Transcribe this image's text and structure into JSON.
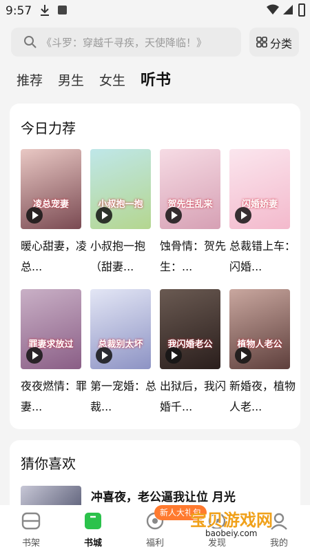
{
  "status_bar": {
    "time": "9:57"
  },
  "search": {
    "placeholder": "《斗罗：穿越千寻疾，天使降临！》"
  },
  "category_button": {
    "label": "分类"
  },
  "tabs": [
    {
      "label": "推荐",
      "active": false
    },
    {
      "label": "男生",
      "active": false
    },
    {
      "label": "女生",
      "active": false
    },
    {
      "label": "听书",
      "active": true
    }
  ],
  "recommend": {
    "title": "今日力荐",
    "books": [
      {
        "title": "暖心甜妻，凌总...",
        "cover_text": "凌总宠妻"
      },
      {
        "title": "小叔抱一抱（甜妻...",
        "cover_text": "小叔抱一抱"
      },
      {
        "title": "蚀骨情：贺先生：...",
        "cover_text": "贺先生乱来"
      },
      {
        "title": "总裁错上车：闪婚...",
        "cover_text": "闪婚娇妻"
      },
      {
        "title": "夜夜燃情：罪妻...",
        "cover_text": "罪妻求放过"
      },
      {
        "title": "第一宠婚：总裁...",
        "cover_text": "总裁别太坏"
      },
      {
        "title": "出狱后，我闪婚千...",
        "cover_text": "我闪婚老公"
      },
      {
        "title": "新婚夜，植物人老...",
        "cover_text": "植物人老公"
      }
    ]
  },
  "guess": {
    "title": "猜你喜欢",
    "first_item_title": "冲喜夜，老公逼我让位 月光"
  },
  "bottom_nav": [
    {
      "label": "书架",
      "icon": "bookshelf-icon",
      "active": false
    },
    {
      "label": "书城",
      "icon": "bookstore-icon",
      "active": true
    },
    {
      "label": "福利",
      "icon": "gift-icon",
      "active": false
    },
    {
      "label": "发现",
      "icon": "discover-icon",
      "active": false
    },
    {
      "label": "我的",
      "icon": "profile-icon",
      "active": false
    }
  ],
  "promo_badge": "新人大礼包",
  "watermark": {
    "text": "宝贝游戏网",
    "url": "baobeiy.com"
  },
  "colors": {
    "accent": "#2bc24b",
    "promo": "#ff7a2f",
    "background": "#f4f4f4"
  }
}
